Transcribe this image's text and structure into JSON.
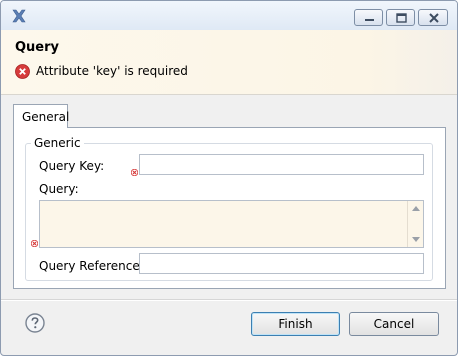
{
  "window": {
    "title": "",
    "controls": [
      "minimize-icon",
      "maximize-icon",
      "close-icon"
    ]
  },
  "header": {
    "title": "Query",
    "message": "Attribute 'key' is required",
    "message_icon": "error-icon"
  },
  "tabs": [
    {
      "label": "General",
      "selected": true
    }
  ],
  "group": {
    "legend": "Generic",
    "query_key": {
      "label": "Query Key:",
      "value": "",
      "required": true
    },
    "query": {
      "label": "Query:",
      "value": "",
      "required": true
    },
    "query_reference": {
      "label": "Query Reference:",
      "value": ""
    }
  },
  "footer": {
    "help_icon": "help-icon",
    "finish_label": "Finish",
    "cancel_label": "Cancel"
  },
  "colors": {
    "header_bg": "#fdf8ec",
    "required_field_bg": "#fcf6e9",
    "error_red": "#d63b3b",
    "default_button_border": "#3c7fb1"
  }
}
